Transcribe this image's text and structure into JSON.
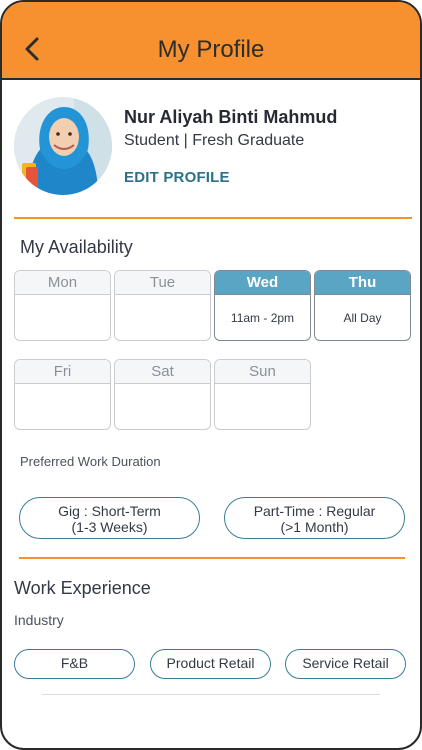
{
  "header": {
    "title": "My Profile",
    "back_icon": "chevron-left-icon"
  },
  "profile": {
    "name": "Nur Aliyah Binti Mahmud",
    "role": "Student | Fresh Graduate",
    "edit_label": "EDIT PROFILE"
  },
  "availability": {
    "title": "My Availability",
    "days": [
      {
        "name": "Mon",
        "time": "",
        "active": false
      },
      {
        "name": "Tue",
        "time": "",
        "active": false
      },
      {
        "name": "Wed",
        "time": "11am - 2pm",
        "active": true
      },
      {
        "name": "Thu",
        "time": "All Day",
        "active": true
      },
      {
        "name": "Fri",
        "time": "",
        "active": false
      },
      {
        "name": "Sat",
        "time": "",
        "active": false
      },
      {
        "name": "Sun",
        "time": "",
        "active": false
      }
    ],
    "duration_label": "Preferred Work Duration",
    "durations": [
      {
        "line1": "Gig : Short-Term",
        "line2": "(1-3 Weeks)"
      },
      {
        "line1": "Part-Time : Regular",
        "line2": "(>1 Month)"
      }
    ]
  },
  "experience": {
    "title": "Work Experience",
    "industry_label": "Industry",
    "industries": [
      "F&B",
      "Product Retail",
      "Service Retail"
    ]
  },
  "colors": {
    "header": "#f7902f",
    "accent": "#2e7088",
    "day_active": "#5aa4c4",
    "pill_border": "#3a7e96"
  }
}
